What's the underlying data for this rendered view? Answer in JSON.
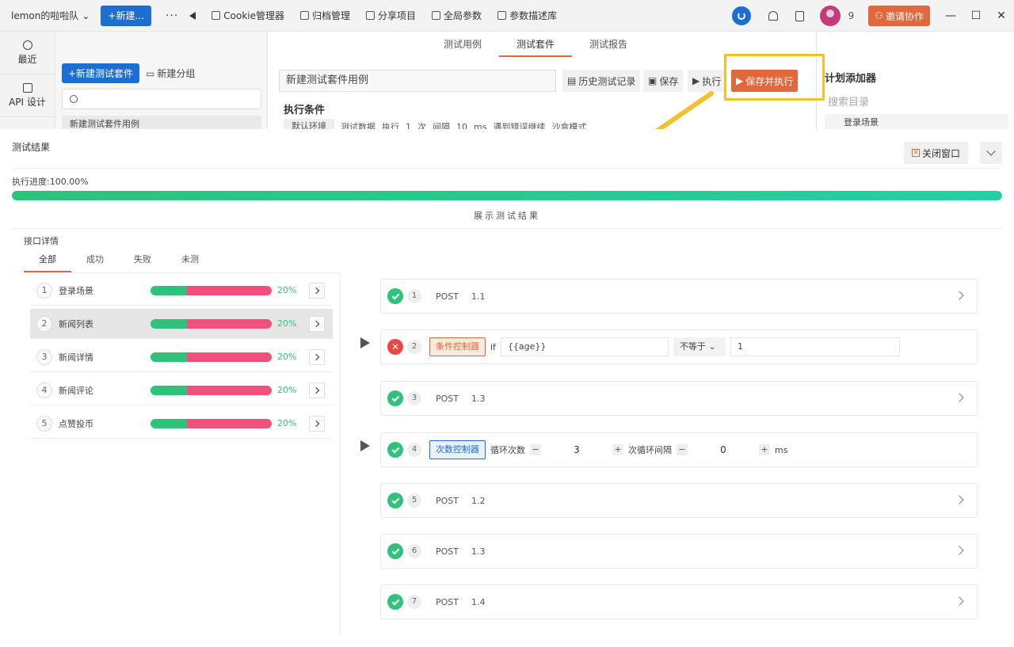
{
  "topbar": {
    "team": "lemon的啦啦队",
    "new_label": "+新建...",
    "more": "···",
    "nav": [
      {
        "label": "Cookie管理器"
      },
      {
        "label": "归档管理"
      },
      {
        "label": "分享项目"
      },
      {
        "label": "全局参数"
      },
      {
        "label": "参数描述库"
      }
    ],
    "avatar_count": "9",
    "invite_label": "邀请协作",
    "win_min": "—",
    "win_max": "☐",
    "win_close": "✕"
  },
  "rail": [
    {
      "label": "最近"
    },
    {
      "label": "API 设计"
    }
  ],
  "sidepanel": {
    "new_suite": "+新建测试套件",
    "new_group": "新建分组",
    "tree_item": "新建测试套件用例"
  },
  "main": {
    "tabs": [
      {
        "label": "测试用例"
      },
      {
        "label": "测试套件"
      },
      {
        "label": "测试报告"
      }
    ],
    "suite_name": "新建测试套件用例",
    "history": "历史测试记录",
    "save": "保存",
    "run": "执行",
    "save_run": "保存并执行",
    "exec_title": "执行条件",
    "exec_row": [
      "默认环境",
      "测试数据",
      "执行",
      "1",
      "次",
      "间隔",
      "10",
      "ms",
      "遇到错误继续",
      "沙盒模式"
    ]
  },
  "rightpanel": {
    "title": "计划添加器",
    "search": "搜索目录",
    "item": "登录场景"
  },
  "modal": {
    "title": "测试结果",
    "close": "关闭窗口",
    "progress_label": "执行进度:100.00%",
    "progress": 1.0,
    "show_result": "展示测试结果",
    "detail_title": "接口详情",
    "filter_tabs": [
      "全部",
      "成功",
      "失败",
      "未测"
    ],
    "scenarios": [
      {
        "num": "1",
        "name": "登录场景",
        "pct": "20%",
        "ratio": 0.3
      },
      {
        "num": "2",
        "name": "新闻列表",
        "pct": "20%",
        "ratio": 0.3
      },
      {
        "num": "3",
        "name": "新闻详情",
        "pct": "20%",
        "ratio": 0.3
      },
      {
        "num": "4",
        "name": "新闻评论",
        "pct": "20%",
        "ratio": 0.3
      },
      {
        "num": "5",
        "name": "点赞投币",
        "pct": "20%",
        "ratio": 0.3
      }
    ],
    "steps": {
      "s1": {
        "num": "1",
        "method": "POST",
        "name": "1.1"
      },
      "s2": {
        "num": "2",
        "tag": "条件控制器",
        "if": "if",
        "expr": "{{age}}",
        "op": "不等于",
        "value": "1"
      },
      "s3": {
        "num": "3",
        "method": "POST",
        "name": "1.3"
      },
      "s4": {
        "num": "4",
        "tag": "次数控制器",
        "loop_label": "循环次数",
        "loop_val": "3",
        "interval_label": "次循环间隔",
        "interval_val": "0",
        "unit": "ms"
      },
      "s5": {
        "num": "5",
        "method": "POST",
        "name": "1.2"
      },
      "s6": {
        "num": "6",
        "method": "POST",
        "name": "1.3"
      },
      "s7": {
        "num": "7",
        "method": "POST",
        "name": "1.4"
      }
    }
  },
  "colors": {
    "accent": "#1c6fd1",
    "orange": "#e0683c",
    "success": "#2fc27a",
    "fail": "#f0517c",
    "highlight": "#f2c12e"
  }
}
